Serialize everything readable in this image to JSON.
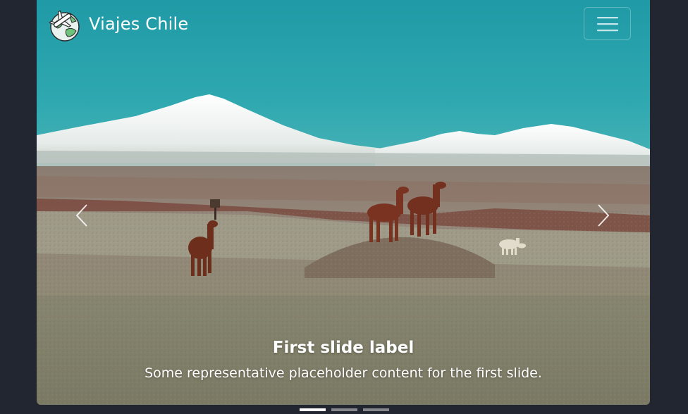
{
  "navbar": {
    "brand": "Viajes Chile",
    "logo_icon": "globe-airplane-icon",
    "toggler_icon": "hamburger-menu-icon"
  },
  "carousel": {
    "prev_icon": "chevron-left-icon",
    "next_icon": "chevron-right-icon",
    "slides": [
      {
        "label": "First slide label",
        "text": "Some representative placeholder content for the first slide."
      }
    ],
    "indicators": [
      {
        "active": true
      },
      {
        "active": false
      },
      {
        "active": false
      }
    ],
    "active_index": 0
  },
  "colors": {
    "page_background": "#212631",
    "sky": "#2aa3ad",
    "text": "#ffffff"
  }
}
